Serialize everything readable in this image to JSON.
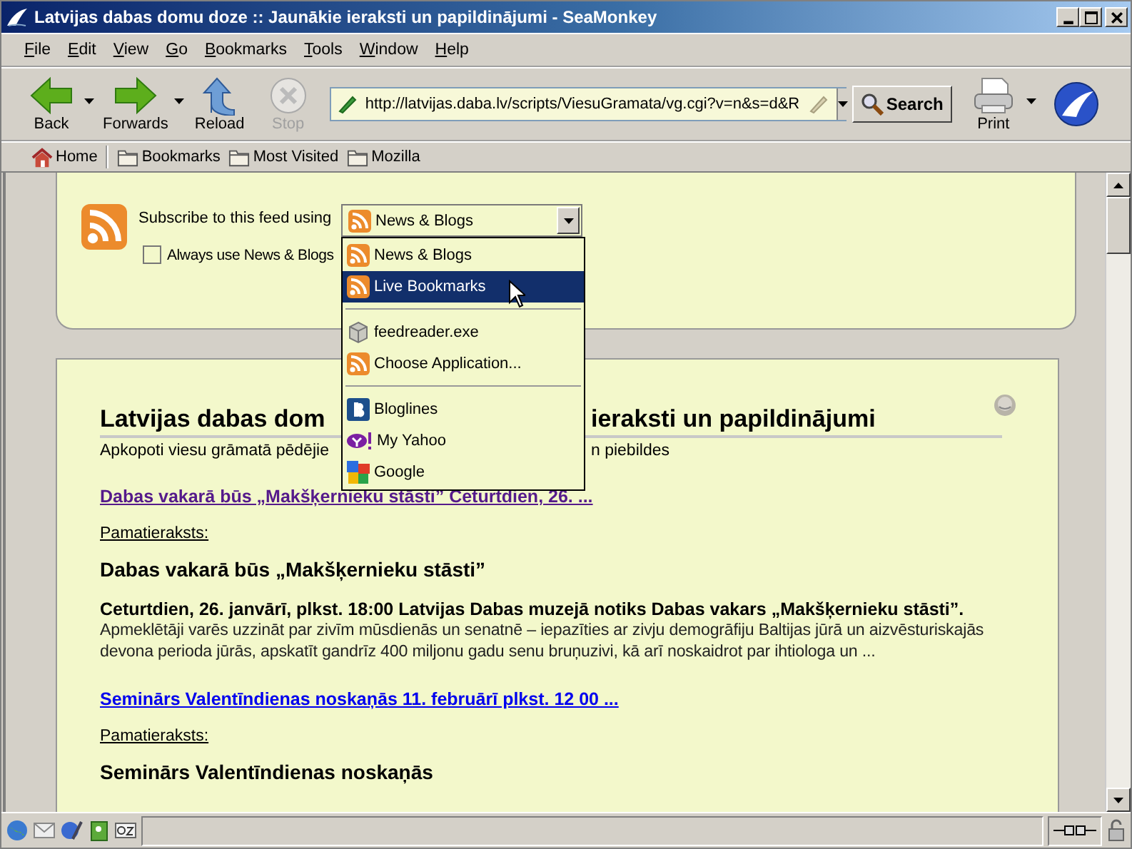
{
  "window": {
    "title": "Latvijas dabas domu doze :: Jaunākie ieraksti un papildinājumi - SeaMonkey"
  },
  "menu": [
    "File",
    "Edit",
    "View",
    "Go",
    "Bookmarks",
    "Tools",
    "Window",
    "Help"
  ],
  "nav_buttons": [
    {
      "kind": "back",
      "label": "Back",
      "disabled": false,
      "menu": true
    },
    {
      "kind": "forward",
      "label": "Forwards",
      "disabled": false,
      "menu": true
    },
    {
      "kind": "reload",
      "label": "Reload",
      "disabled": false,
      "menu": false
    },
    {
      "kind": "stop",
      "label": "Stop",
      "disabled": true,
      "menu": false
    }
  ],
  "url": "http://latvijas.daba.lv/scripts/ViesuGramata/vg.cgi?v=n&s=d&R",
  "search_button": "Search",
  "print": {
    "label": "Print",
    "menu": true
  },
  "bookmarks_bar": [
    {
      "kind": "home",
      "label": "Home"
    },
    {
      "kind": "folder",
      "label": "Bookmarks"
    },
    {
      "kind": "folder",
      "label": "Most Visited"
    },
    {
      "kind": "folder",
      "label": "Mozilla"
    }
  ],
  "feed": {
    "label": "Subscribe to this feed using",
    "select": "News & Blogs",
    "always": {
      "label": "Always use News & Blogs",
      "checked": false
    }
  },
  "popup": {
    "groups": [
      [
        {
          "kind": "rss",
          "label": "News & Blogs",
          "selected": false
        },
        {
          "kind": "rss",
          "label": "Live Bookmarks",
          "selected": true
        }
      ],
      [
        {
          "kind": "app",
          "label": "feedreader.exe",
          "selected": false
        },
        {
          "kind": "rss",
          "label": "Choose Application...",
          "selected": false
        }
      ],
      [
        {
          "kind": "bloglines",
          "label": "Bloglines",
          "selected": false
        },
        {
          "kind": "yahoo",
          "label": "My Yahoo",
          "selected": false
        },
        {
          "kind": "google",
          "label": "Google",
          "selected": false
        }
      ]
    ]
  },
  "article": {
    "heading_parts": [
      "Latvijas dabas dom",
      "ieraksti un papildinājumi"
    ],
    "subtitle_parts": [
      "Apkopoti viesu grāmatā pēdējie",
      "n piebildes"
    ],
    "entries": [
      {
        "link": "Dabas vakarā būs „Makšķernieku stāsti” Ceturtdien, 26. ...",
        "visited": true,
        "base_label": "Pamatieraksts:",
        "title": "Dabas vakarā būs „Makšķernieku stāsti”",
        "lead": "Ceturtdien, 26. janvārī, plkst. 18:00 Latvijas Dabas muzejā notiks Dabas vakars „Makšķernieku stāsti”.",
        "body": "Apmeklētāji varēs uzzināt par zivīm mūsdienās un senatnē – iepazīties ar zivju demogrāfiju Baltijas jūrā un aizvēsturiskajās devona perioda jūrās, apskatīt gandrīz 400 miljonu gadu senu bruņuzivi, kā arī noskaidrot par ihtiologa un ..."
      },
      {
        "link": "Seminārs Valentīndienas noskaņās 11. februārī plkst. 12 00 ...",
        "visited": false,
        "base_label": "Pamatieraksts:",
        "title": "Seminārs Valentīndienas noskaņās"
      }
    ]
  }
}
